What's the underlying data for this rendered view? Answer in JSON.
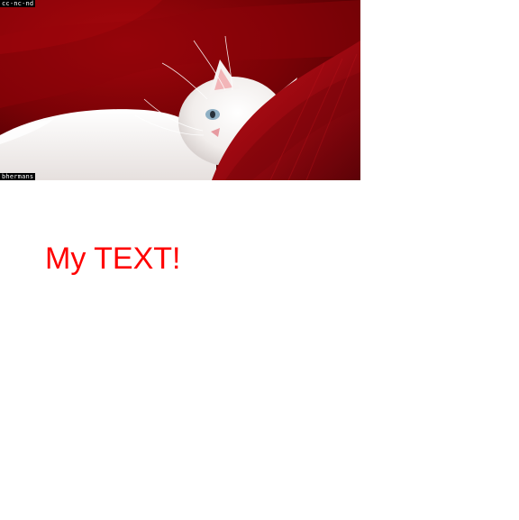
{
  "photo": {
    "license_label": "cc-nc-nd",
    "author_label": "bhermans"
  },
  "caption": {
    "text": "My TEXT!",
    "color": "#ff0000"
  },
  "colors": {
    "background": "#ffffff",
    "velvet": "#9b0a10",
    "fur": "#f4f2f0"
  }
}
